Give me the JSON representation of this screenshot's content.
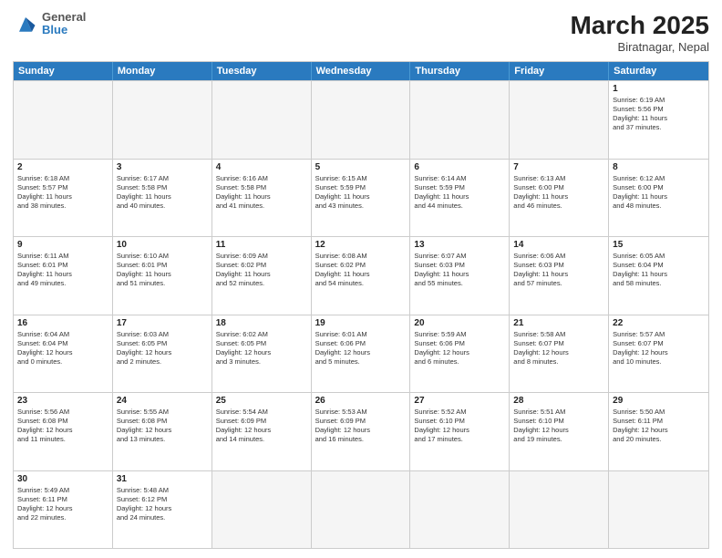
{
  "header": {
    "logo_general": "General",
    "logo_blue": "Blue",
    "month_year": "March 2025",
    "location": "Biratnagar, Nepal"
  },
  "weekdays": [
    "Sunday",
    "Monday",
    "Tuesday",
    "Wednesday",
    "Thursday",
    "Friday",
    "Saturday"
  ],
  "rows": [
    [
      {
        "day": "",
        "detail": "",
        "empty": true
      },
      {
        "day": "",
        "detail": "",
        "empty": true
      },
      {
        "day": "",
        "detail": "",
        "empty": true
      },
      {
        "day": "",
        "detail": "",
        "empty": true
      },
      {
        "day": "",
        "detail": "",
        "empty": true
      },
      {
        "day": "",
        "detail": "",
        "empty": true
      },
      {
        "day": "1",
        "detail": "Sunrise: 6:19 AM\nSunset: 5:56 PM\nDaylight: 11 hours\nand 37 minutes."
      }
    ],
    [
      {
        "day": "2",
        "detail": "Sunrise: 6:18 AM\nSunset: 5:57 PM\nDaylight: 11 hours\nand 38 minutes."
      },
      {
        "day": "3",
        "detail": "Sunrise: 6:17 AM\nSunset: 5:58 PM\nDaylight: 11 hours\nand 40 minutes."
      },
      {
        "day": "4",
        "detail": "Sunrise: 6:16 AM\nSunset: 5:58 PM\nDaylight: 11 hours\nand 41 minutes."
      },
      {
        "day": "5",
        "detail": "Sunrise: 6:15 AM\nSunset: 5:59 PM\nDaylight: 11 hours\nand 43 minutes."
      },
      {
        "day": "6",
        "detail": "Sunrise: 6:14 AM\nSunset: 5:59 PM\nDaylight: 11 hours\nand 44 minutes."
      },
      {
        "day": "7",
        "detail": "Sunrise: 6:13 AM\nSunset: 6:00 PM\nDaylight: 11 hours\nand 46 minutes."
      },
      {
        "day": "8",
        "detail": "Sunrise: 6:12 AM\nSunset: 6:00 PM\nDaylight: 11 hours\nand 48 minutes."
      }
    ],
    [
      {
        "day": "9",
        "detail": "Sunrise: 6:11 AM\nSunset: 6:01 PM\nDaylight: 11 hours\nand 49 minutes."
      },
      {
        "day": "10",
        "detail": "Sunrise: 6:10 AM\nSunset: 6:01 PM\nDaylight: 11 hours\nand 51 minutes."
      },
      {
        "day": "11",
        "detail": "Sunrise: 6:09 AM\nSunset: 6:02 PM\nDaylight: 11 hours\nand 52 minutes."
      },
      {
        "day": "12",
        "detail": "Sunrise: 6:08 AM\nSunset: 6:02 PM\nDaylight: 11 hours\nand 54 minutes."
      },
      {
        "day": "13",
        "detail": "Sunrise: 6:07 AM\nSunset: 6:03 PM\nDaylight: 11 hours\nand 55 minutes."
      },
      {
        "day": "14",
        "detail": "Sunrise: 6:06 AM\nSunset: 6:03 PM\nDaylight: 11 hours\nand 57 minutes."
      },
      {
        "day": "15",
        "detail": "Sunrise: 6:05 AM\nSunset: 6:04 PM\nDaylight: 11 hours\nand 58 minutes."
      }
    ],
    [
      {
        "day": "16",
        "detail": "Sunrise: 6:04 AM\nSunset: 6:04 PM\nDaylight: 12 hours\nand 0 minutes."
      },
      {
        "day": "17",
        "detail": "Sunrise: 6:03 AM\nSunset: 6:05 PM\nDaylight: 12 hours\nand 2 minutes."
      },
      {
        "day": "18",
        "detail": "Sunrise: 6:02 AM\nSunset: 6:05 PM\nDaylight: 12 hours\nand 3 minutes."
      },
      {
        "day": "19",
        "detail": "Sunrise: 6:01 AM\nSunset: 6:06 PM\nDaylight: 12 hours\nand 5 minutes."
      },
      {
        "day": "20",
        "detail": "Sunrise: 5:59 AM\nSunset: 6:06 PM\nDaylight: 12 hours\nand 6 minutes."
      },
      {
        "day": "21",
        "detail": "Sunrise: 5:58 AM\nSunset: 6:07 PM\nDaylight: 12 hours\nand 8 minutes."
      },
      {
        "day": "22",
        "detail": "Sunrise: 5:57 AM\nSunset: 6:07 PM\nDaylight: 12 hours\nand 10 minutes."
      }
    ],
    [
      {
        "day": "23",
        "detail": "Sunrise: 5:56 AM\nSunset: 6:08 PM\nDaylight: 12 hours\nand 11 minutes."
      },
      {
        "day": "24",
        "detail": "Sunrise: 5:55 AM\nSunset: 6:08 PM\nDaylight: 12 hours\nand 13 minutes."
      },
      {
        "day": "25",
        "detail": "Sunrise: 5:54 AM\nSunset: 6:09 PM\nDaylight: 12 hours\nand 14 minutes."
      },
      {
        "day": "26",
        "detail": "Sunrise: 5:53 AM\nSunset: 6:09 PM\nDaylight: 12 hours\nand 16 minutes."
      },
      {
        "day": "27",
        "detail": "Sunrise: 5:52 AM\nSunset: 6:10 PM\nDaylight: 12 hours\nand 17 minutes."
      },
      {
        "day": "28",
        "detail": "Sunrise: 5:51 AM\nSunset: 6:10 PM\nDaylight: 12 hours\nand 19 minutes."
      },
      {
        "day": "29",
        "detail": "Sunrise: 5:50 AM\nSunset: 6:11 PM\nDaylight: 12 hours\nand 20 minutes."
      }
    ],
    [
      {
        "day": "30",
        "detail": "Sunrise: 5:49 AM\nSunset: 6:11 PM\nDaylight: 12 hours\nand 22 minutes."
      },
      {
        "day": "31",
        "detail": "Sunrise: 5:48 AM\nSunset: 6:12 PM\nDaylight: 12 hours\nand 24 minutes."
      },
      {
        "day": "",
        "detail": "",
        "empty": true
      },
      {
        "day": "",
        "detail": "",
        "empty": true
      },
      {
        "day": "",
        "detail": "",
        "empty": true
      },
      {
        "day": "",
        "detail": "",
        "empty": true
      },
      {
        "day": "",
        "detail": "",
        "empty": true
      }
    ]
  ]
}
